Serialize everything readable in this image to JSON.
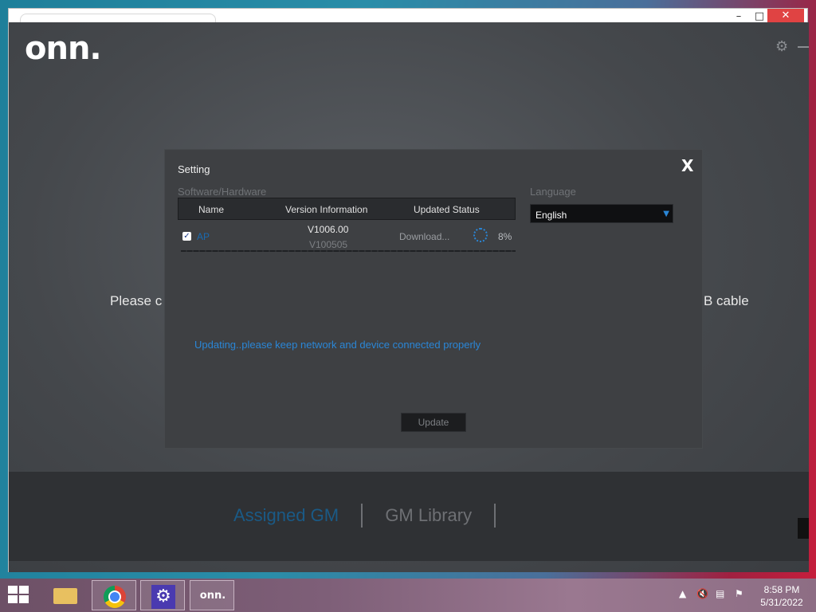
{
  "window": {
    "minimize_glyph": "–",
    "maximize_glyph": "□",
    "close_glyph": "✕"
  },
  "app": {
    "logo": "onn.",
    "prompt_left": "Please c",
    "prompt_right": "B cable",
    "nav_tabs": [
      {
        "label": "Assigned GM",
        "active": true
      },
      {
        "label": "GM Library",
        "active": false
      }
    ]
  },
  "dialog": {
    "title": "Setting",
    "close_label": "X",
    "software_section_label": "Software/Hardware",
    "table_headers": [
      "Name",
      "Version Information",
      "Updated Status"
    ],
    "rows": [
      {
        "checked": true,
        "name": "AP",
        "version_new": "V1006.00",
        "version_old": "V100505",
        "status": "Download...",
        "progress_label": "8%"
      }
    ],
    "language_label": "Language",
    "language_value": "English",
    "message": "Updating..please keep network and device connected properly",
    "update_button": "Update"
  },
  "taskbar": {
    "pinned": [
      "windows-explorer",
      "google-chrome",
      "settings",
      "onn"
    ],
    "onn_label": "onn.",
    "clock_time": "8:58 PM",
    "clock_date": "5/31/2022"
  },
  "colors": {
    "accent_blue": "#2a86d6",
    "dialog_bg": "#3e4043",
    "app_bg": "#45484c"
  }
}
